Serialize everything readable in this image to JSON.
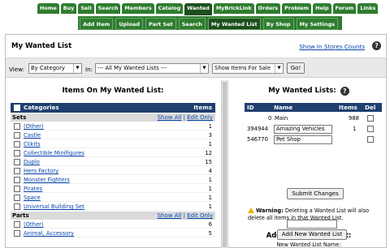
{
  "nav": {
    "primary_tabs": [
      "Home",
      "Buy",
      "Sell",
      "Search",
      "Members",
      "Catalog",
      "Wanted",
      "MyBrickLink",
      "Orders",
      "Problem",
      "Help",
      "Forum",
      "Links"
    ],
    "secondary_tabs": [
      "Add Item",
      "Upload",
      "Part Set",
      "Search",
      "My Wanted List",
      "By Shop",
      "My Settings"
    ]
  },
  "page": {
    "title": "My Wanted List",
    "store_link": "Show In Stores Counts",
    "help": "?"
  },
  "filters": {
    "view_label": "View:",
    "view_value": "By Category",
    "in_label": "In:",
    "in_value": "--- All My Wanted Lists ---",
    "show_value": "Show Items For Sale",
    "go_label": "Go!"
  },
  "items_panel": {
    "title": "Items On My Wanted List:",
    "header_categories": "Categories",
    "header_items": "Items",
    "sets_label": "Sets",
    "parts_label": "Parts",
    "show_all": "Show All",
    "edit_only": "Edit Only",
    "sets": [
      {
        "name": "(Other)",
        "count": "1"
      },
      {
        "name": "Castle",
        "count": "3"
      },
      {
        "name": "Clikits",
        "count": "1"
      },
      {
        "name": "Collectible Minifigures",
        "count": "12"
      },
      {
        "name": "Duplo",
        "count": "15"
      },
      {
        "name": "Hero Factory",
        "count": "4"
      },
      {
        "name": "Monster Fighters",
        "count": "1"
      },
      {
        "name": "Pirates",
        "count": "1"
      },
      {
        "name": "Space",
        "count": "1"
      },
      {
        "name": "Universal Building Set",
        "count": "1"
      }
    ],
    "parts": [
      {
        "name": "(Other)",
        "count": "6"
      },
      {
        "name": "Animal, Accessory",
        "count": "5"
      }
    ]
  },
  "lists_panel": {
    "title": "My Wanted Lists:",
    "col_id": "ID",
    "col_name": "Name",
    "col_items": "Items",
    "col_del": "Del",
    "lists": [
      {
        "id": "0",
        "name": "Main",
        "items": "988"
      },
      {
        "id": "394944",
        "name": "Amazing Vehicles",
        "items": "1"
      },
      {
        "id": "546770",
        "name": "Pet Shop",
        "items": ""
      }
    ],
    "submit_label": "Submit Changes",
    "warning_bold": "Warning:",
    "warning_text": "Deleting a Wanted List will also delete all items in that Wanted List.",
    "add_title": "Add New Wanted List:",
    "new_name_label": "New Wanted List Name:",
    "new_name_value": "",
    "add_button": "Add New Wanted List"
  },
  "colors": {
    "tab_green": "#2f7d2f",
    "tab_active": "#1d4f1d",
    "table_header": "#1f3f6f",
    "link": "#0645ad"
  }
}
